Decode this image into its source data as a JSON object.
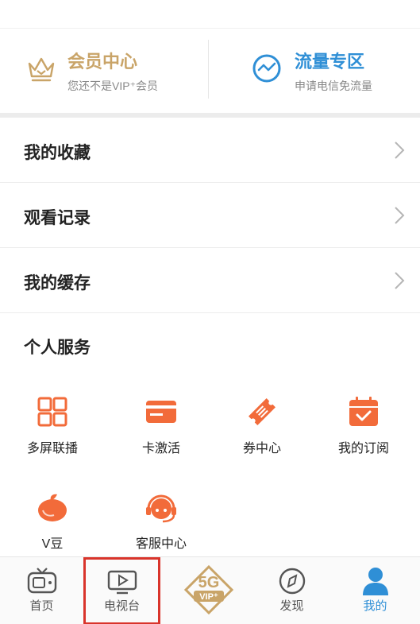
{
  "promo": {
    "vip": {
      "title": "会员中心",
      "subtitle": "您还不是VIP⁺会员"
    },
    "flow": {
      "title": "流量专区",
      "subtitle": "申请电信免流量"
    }
  },
  "list": [
    {
      "label": "我的收藏"
    },
    {
      "label": "观看记录"
    },
    {
      "label": "我的缓存"
    }
  ],
  "services": {
    "title": "个人服务",
    "items": [
      {
        "label": "多屏联播",
        "icon": "multi-screen-icon"
      },
      {
        "label": "卡激活",
        "icon": "card-icon"
      },
      {
        "label": "券中心",
        "icon": "ticket-icon"
      },
      {
        "label": "我的订阅",
        "icon": "calendar-icon"
      },
      {
        "label": "V豆",
        "icon": "bean-icon"
      },
      {
        "label": "客服中心",
        "icon": "headset-icon"
      }
    ]
  },
  "tabbar": {
    "items": [
      {
        "label": "首页",
        "icon": "tv-icon"
      },
      {
        "label": "电视台",
        "icon": "play-icon"
      },
      {
        "label": "",
        "icon": "5g-vip-icon"
      },
      {
        "label": "发现",
        "icon": "compass-icon"
      },
      {
        "label": "我的",
        "icon": "person-icon"
      }
    ],
    "active_index": 4,
    "highlighted_index": 1
  },
  "colors": {
    "accent_blue": "#2f8fd6",
    "vip_gold": "#c9a468",
    "service_orange": "#f26b3a",
    "highlight_red": "#d9342b"
  }
}
